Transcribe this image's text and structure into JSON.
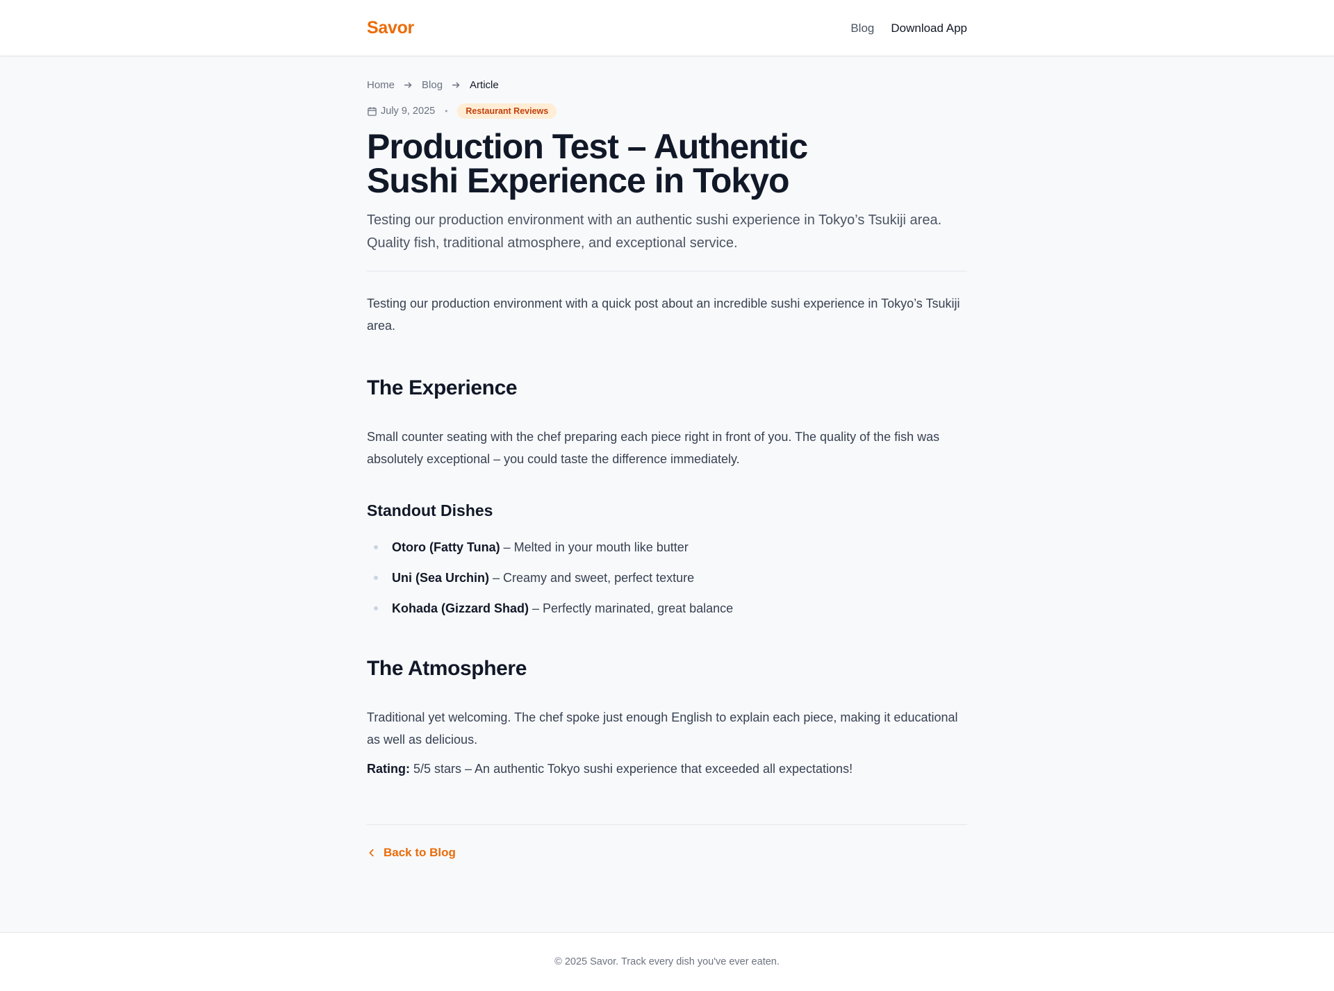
{
  "header": {
    "brand": "Savor",
    "nav": {
      "blog": "Blog",
      "download": "Download App"
    }
  },
  "breadcrumb": {
    "home": "Home",
    "blog": "Blog",
    "current": "Article"
  },
  "meta": {
    "date": "July 9, 2025",
    "separator": "•",
    "category": "Restaurant Reviews"
  },
  "article": {
    "title": "Production Test – Authentic Sushi Experience in Tokyo",
    "subtitle": "Testing our production environment with an authentic sushi experience in Tokyo’s Tsukiji area. Quality fish, traditional atmosphere, and exceptional service.",
    "intro": "Testing our production environment with a quick post about an incredible sushi experience in Tokyo’s Tsukiji area.",
    "section1_heading": "The Experience",
    "section1_body": "Small counter seating with the chef preparing each piece right in front of you. The quality of the fish was absolutely exceptional – you could taste the difference immediately.",
    "dishes_heading": "Standout Dishes",
    "dishes": [
      {
        "name": "Otoro (Fatty Tuna)",
        "desc": " – Melted in your mouth like butter"
      },
      {
        "name": "Uni (Sea Urchin)",
        "desc": " – Creamy and sweet, perfect texture"
      },
      {
        "name": "Kohada (Gizzard Shad)",
        "desc": " – Perfectly marinated, great balance"
      }
    ],
    "section2_heading": "The Atmosphere",
    "section2_body": "Traditional yet welcoming. The chef spoke just enough English to explain each piece, making it educational as well as delicious.",
    "rating_label": "Rating:",
    "rating_text": " 5/5 stars – An authentic Tokyo sushi experience that exceeded all expectations!"
  },
  "back_link": "Back to Blog",
  "footer": "© 2025 Savor. Track every dish you've ever eaten.",
  "colors": {
    "accent": "#ea6c0a",
    "tag_bg": "#ffedd5",
    "tag_text": "#c2410c"
  },
  "icons": {
    "breadcrumb_separator": "arrow-right-icon",
    "date": "calendar-icon",
    "back": "chevron-left-icon"
  }
}
